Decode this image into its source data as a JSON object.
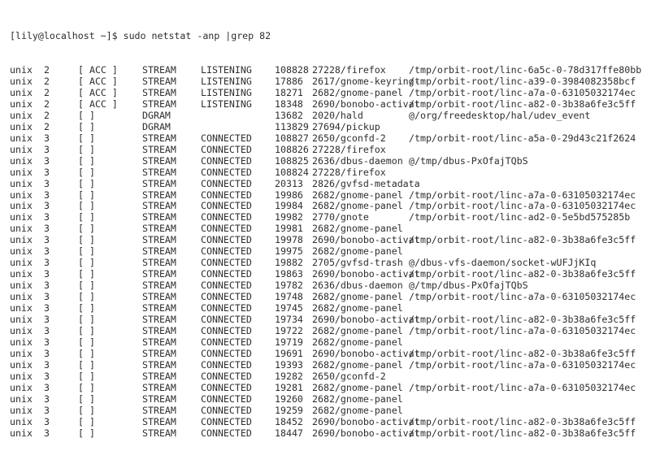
{
  "terminal": {
    "prompt": "[lily@localhost ~]$ sudo netstat -anp |grep 82",
    "rows": [
      {
        "proto": "unix",
        "refcnt": "2",
        "flags": "[ ACC ]",
        "type": "STREAM",
        "state": "LISTENING",
        "inode": "108828",
        "pid_program": "27228/firefox",
        "path": "/tmp/orbit-root/linc-6a5c-0-78d317ffe80bb"
      },
      {
        "proto": "unix",
        "refcnt": "2",
        "flags": "[ ACC ]",
        "type": "STREAM",
        "state": "LISTENING",
        "inode": "17886",
        "pid_program": "2617/gnome-keyring-",
        "path": "/tmp/orbit-root/linc-a39-0-3984082358bcf"
      },
      {
        "proto": "unix",
        "refcnt": "2",
        "flags": "[ ACC ]",
        "type": "STREAM",
        "state": "LISTENING",
        "inode": "18271",
        "pid_program": "2682/gnome-panel",
        "path": "/tmp/orbit-root/linc-a7a-0-63105032174ec"
      },
      {
        "proto": "unix",
        "refcnt": "2",
        "flags": "[ ACC ]",
        "type": "STREAM",
        "state": "LISTENING",
        "inode": "18348",
        "pid_program": "2690/bonobo-activat",
        "path": "/tmp/orbit-root/linc-a82-0-3b38a6fe3c5ff"
      },
      {
        "proto": "unix",
        "refcnt": "2",
        "flags": "[ ]",
        "type": "DGRAM",
        "state": "",
        "inode": "13682",
        "pid_program": "2020/hald",
        "path": "@/org/freedesktop/hal/udev_event"
      },
      {
        "proto": "unix",
        "refcnt": "2",
        "flags": "[ ]",
        "type": "DGRAM",
        "state": "",
        "inode": "113829",
        "pid_program": "27694/pickup",
        "path": ""
      },
      {
        "proto": "unix",
        "refcnt": "3",
        "flags": "[ ]",
        "type": "STREAM",
        "state": "CONNECTED",
        "inode": "108827",
        "pid_program": "2650/gconfd-2",
        "path": "/tmp/orbit-root/linc-a5a-0-29d43c21f2624"
      },
      {
        "proto": "unix",
        "refcnt": "3",
        "flags": "[ ]",
        "type": "STREAM",
        "state": "CONNECTED",
        "inode": "108826",
        "pid_program": "27228/firefox",
        "path": ""
      },
      {
        "proto": "unix",
        "refcnt": "3",
        "flags": "[ ]",
        "type": "STREAM",
        "state": "CONNECTED",
        "inode": "108825",
        "pid_program": "2636/dbus-daemon",
        "path": "@/tmp/dbus-PxOfajTQbS"
      },
      {
        "proto": "unix",
        "refcnt": "3",
        "flags": "[ ]",
        "type": "STREAM",
        "state": "CONNECTED",
        "inode": "108824",
        "pid_program": "27228/firefox",
        "path": ""
      },
      {
        "proto": "unix",
        "refcnt": "3",
        "flags": "[ ]",
        "type": "STREAM",
        "state": "CONNECTED",
        "inode": "20313",
        "pid_program": "2826/gvfsd-metadata",
        "path": ""
      },
      {
        "proto": "unix",
        "refcnt": "3",
        "flags": "[ ]",
        "type": "STREAM",
        "state": "CONNECTED",
        "inode": "19986",
        "pid_program": "2682/gnome-panel",
        "path": "/tmp/orbit-root/linc-a7a-0-63105032174ec"
      },
      {
        "proto": "unix",
        "refcnt": "3",
        "flags": "[ ]",
        "type": "STREAM",
        "state": "CONNECTED",
        "inode": "19984",
        "pid_program": "2682/gnome-panel",
        "path": "/tmp/orbit-root/linc-a7a-0-63105032174ec"
      },
      {
        "proto": "unix",
        "refcnt": "3",
        "flags": "[ ]",
        "type": "STREAM",
        "state": "CONNECTED",
        "inode": "19982",
        "pid_program": "2770/gnote",
        "path": "/tmp/orbit-root/linc-ad2-0-5e5bd575285b"
      },
      {
        "proto": "unix",
        "refcnt": "3",
        "flags": "[ ]",
        "type": "STREAM",
        "state": "CONNECTED",
        "inode": "19981",
        "pid_program": "2682/gnome-panel",
        "path": ""
      },
      {
        "proto": "unix",
        "refcnt": "3",
        "flags": "[ ]",
        "type": "STREAM",
        "state": "CONNECTED",
        "inode": "19978",
        "pid_program": "2690/bonobo-activat",
        "path": "/tmp/orbit-root/linc-a82-0-3b38a6fe3c5ff"
      },
      {
        "proto": "unix",
        "refcnt": "3",
        "flags": "[ ]",
        "type": "STREAM",
        "state": "CONNECTED",
        "inode": "19975",
        "pid_program": "2682/gnome-panel",
        "path": ""
      },
      {
        "proto": "unix",
        "refcnt": "3",
        "flags": "[ ]",
        "type": "STREAM",
        "state": "CONNECTED",
        "inode": "19882",
        "pid_program": "2705/gvfsd-trash",
        "path": "@/dbus-vfs-daemon/socket-wUFJjKIq"
      },
      {
        "proto": "unix",
        "refcnt": "3",
        "flags": "[ ]",
        "type": "STREAM",
        "state": "CONNECTED",
        "inode": "19863",
        "pid_program": "2690/bonobo-activat",
        "path": "/tmp/orbit-root/linc-a82-0-3b38a6fe3c5ff"
      },
      {
        "proto": "unix",
        "refcnt": "3",
        "flags": "[ ]",
        "type": "STREAM",
        "state": "CONNECTED",
        "inode": "19782",
        "pid_program": "2636/dbus-daemon",
        "path": "@/tmp/dbus-PxOfajTQbS"
      },
      {
        "proto": "unix",
        "refcnt": "3",
        "flags": "[ ]",
        "type": "STREAM",
        "state": "CONNECTED",
        "inode": "19748",
        "pid_program": "2682/gnome-panel",
        "path": "/tmp/orbit-root/linc-a7a-0-63105032174ec"
      },
      {
        "proto": "unix",
        "refcnt": "3",
        "flags": "[ ]",
        "type": "STREAM",
        "state": "CONNECTED",
        "inode": "19745",
        "pid_program": "2682/gnome-panel",
        "path": ""
      },
      {
        "proto": "unix",
        "refcnt": "3",
        "flags": "[ ]",
        "type": "STREAM",
        "state": "CONNECTED",
        "inode": "19734",
        "pid_program": "2690/bonobo-activat",
        "path": "/tmp/orbit-root/linc-a82-0-3b38a6fe3c5ff"
      },
      {
        "proto": "unix",
        "refcnt": "3",
        "flags": "[ ]",
        "type": "STREAM",
        "state": "CONNECTED",
        "inode": "19722",
        "pid_program": "2682/gnome-panel",
        "path": "/tmp/orbit-root/linc-a7a-0-63105032174ec"
      },
      {
        "proto": "unix",
        "refcnt": "3",
        "flags": "[ ]",
        "type": "STREAM",
        "state": "CONNECTED",
        "inode": "19719",
        "pid_program": "2682/gnome-panel",
        "path": ""
      },
      {
        "proto": "unix",
        "refcnt": "3",
        "flags": "[ ]",
        "type": "STREAM",
        "state": "CONNECTED",
        "inode": "19691",
        "pid_program": "2690/bonobo-activat",
        "path": "/tmp/orbit-root/linc-a82-0-3b38a6fe3c5ff"
      },
      {
        "proto": "unix",
        "refcnt": "3",
        "flags": "[ ]",
        "type": "STREAM",
        "state": "CONNECTED",
        "inode": "19393",
        "pid_program": "2682/gnome-panel",
        "path": "/tmp/orbit-root/linc-a7a-0-63105032174ec"
      },
      {
        "proto": "unix",
        "refcnt": "3",
        "flags": "[ ]",
        "type": "STREAM",
        "state": "CONNECTED",
        "inode": "19282",
        "pid_program": "2650/gconfd-2",
        "path": ""
      },
      {
        "proto": "unix",
        "refcnt": "3",
        "flags": "[ ]",
        "type": "STREAM",
        "state": "CONNECTED",
        "inode": "19281",
        "pid_program": "2682/gnome-panel",
        "path": "/tmp/orbit-root/linc-a7a-0-63105032174ec"
      },
      {
        "proto": "unix",
        "refcnt": "3",
        "flags": "[ ]",
        "type": "STREAM",
        "state": "CONNECTED",
        "inode": "19260",
        "pid_program": "2682/gnome-panel",
        "path": ""
      },
      {
        "proto": "unix",
        "refcnt": "3",
        "flags": "[ ]",
        "type": "STREAM",
        "state": "CONNECTED",
        "inode": "19259",
        "pid_program": "2682/gnome-panel",
        "path": ""
      },
      {
        "proto": "unix",
        "refcnt": "3",
        "flags": "[ ]",
        "type": "STREAM",
        "state": "CONNECTED",
        "inode": "18452",
        "pid_program": "2690/bonobo-activat",
        "path": "/tmp/orbit-root/linc-a82-0-3b38a6fe3c5ff"
      },
      {
        "proto": "unix",
        "refcnt": "3",
        "flags": "[ ]",
        "type": "STREAM",
        "state": "CONNECTED",
        "inode": "18447",
        "pid_program": "2690/bonobo-activat",
        "path": "/tmp/orbit-root/linc-a82-0-3b38a6fe3c5ff"
      }
    ]
  }
}
